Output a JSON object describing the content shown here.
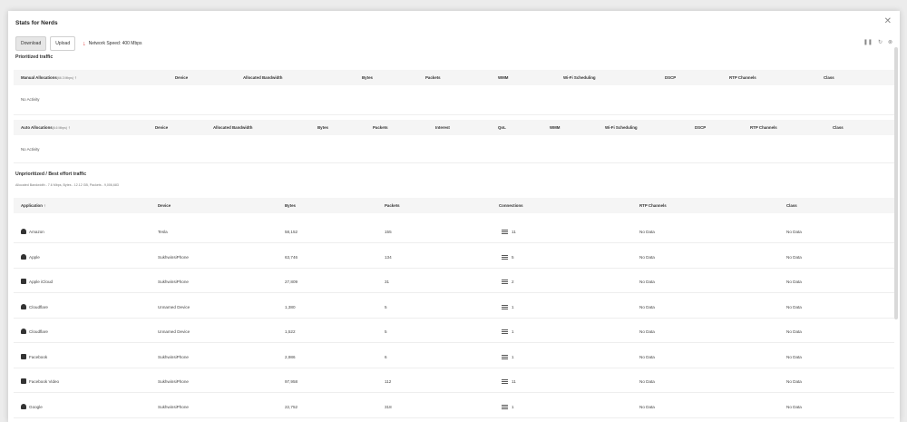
{
  "window": {
    "title": "Stats for Nerds"
  },
  "tabs": [
    {
      "label": "Download",
      "active": true
    },
    {
      "label": "Upload",
      "active": false
    }
  ],
  "network_speed": "Network Speed: 400 Mbps",
  "controls": {
    "pause_icon": "pause-icon",
    "refresh_icon": "refresh-icon",
    "stop_icon": "stop-icon"
  },
  "prioritized": {
    "title": "Prioritized traffic",
    "manual": {
      "label": "Manual Allocations",
      "amount": "(66.3 Mbps)",
      "columns": [
        "Device",
        "Allocated Bandwidth",
        "Bytes",
        "Packets",
        "WMM",
        "Wi-Fi Scheduling",
        "DSCP",
        "RTP Channels",
        "Class"
      ],
      "empty_text": "No Activity"
    },
    "auto": {
      "label": "Auto Allocations",
      "amount": "(6.6 Mbps)",
      "columns": [
        "Device",
        "Allocated Bandwidth",
        "Bytes",
        "Packets",
        "Interest",
        "QoL",
        "WMM",
        "Wi-Fi Scheduling",
        "DSCP",
        "RTP Channels",
        "Class"
      ],
      "empty_text": "No Activity"
    }
  },
  "unprioritized": {
    "title": "Unprioritized / Best effort traffic",
    "summary": "Allocated Bandwidth - 7.6 Mbps, Bytes - 12.12 GB, Packets - 9,006,683",
    "columns": [
      "Application",
      "Device",
      "Bytes",
      "Packets",
      "Connections",
      "RTP Channels",
      "Class"
    ],
    "rows": [
      {
        "app": "Amazon",
        "icon": "cloud-icon",
        "device": "Tesla",
        "bytes": "58,152",
        "packets": "155",
        "connections": "11",
        "rtp": "No Data",
        "class": "No Data"
      },
      {
        "app": "Apple",
        "icon": "cloud-icon",
        "device": "SukhwinsiPhone",
        "bytes": "63,746",
        "packets": "134",
        "connections": "5",
        "rtp": "No Data",
        "class": "No Data"
      },
      {
        "app": "Apple iCloud",
        "icon": "media-icon",
        "device": "SukhwinsiPhone",
        "bytes": "27,809",
        "packets": "31",
        "connections": "2",
        "rtp": "No Data",
        "class": "No Data"
      },
      {
        "app": "Cloudflare",
        "icon": "cloud-icon",
        "device": "Unnamed Device",
        "bytes": "1,380",
        "packets": "5",
        "connections": "1",
        "rtp": "No Data",
        "class": "No Data"
      },
      {
        "app": "Cloudflare",
        "icon": "cloud-icon",
        "device": "Unnamed Device",
        "bytes": "1,522",
        "packets": "5",
        "connections": "1",
        "rtp": "No Data",
        "class": "No Data"
      },
      {
        "app": "Facebook",
        "icon": "social-icon",
        "device": "SukhwinsiPhone",
        "bytes": "2,986",
        "packets": "6",
        "connections": "1",
        "rtp": "No Data",
        "class": "No Data"
      },
      {
        "app": "Facebook Video",
        "icon": "video-icon",
        "device": "SukhwinsiPhone",
        "bytes": "97,958",
        "packets": "112",
        "connections": "11",
        "rtp": "No Data",
        "class": "No Data"
      },
      {
        "app": "Google",
        "icon": "cloud-icon",
        "device": "SukhwinsiPhone",
        "bytes": "22,752",
        "packets": "318",
        "connections": "1",
        "rtp": "No Data",
        "class": "No Data"
      }
    ]
  }
}
